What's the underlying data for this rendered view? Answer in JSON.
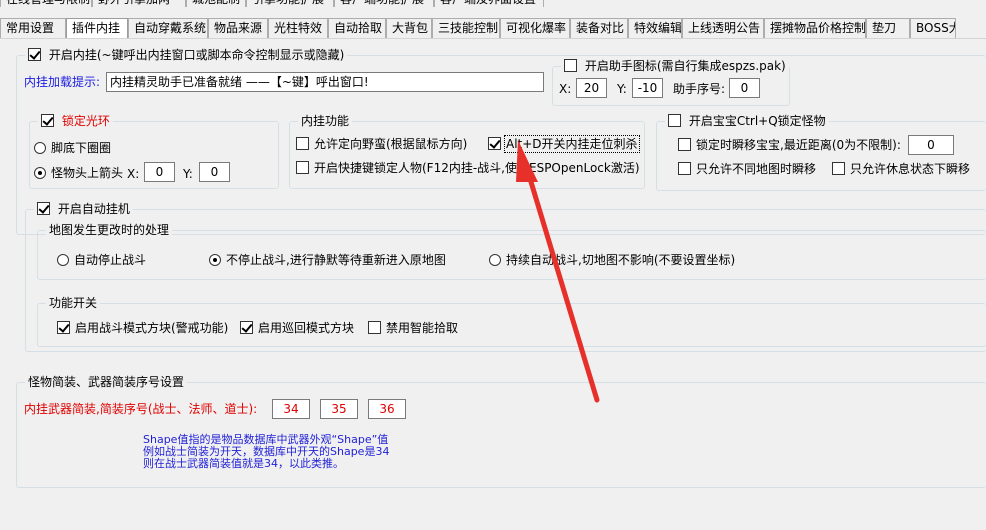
{
  "tabs_row1": [
    "在线管理与限制",
    "野外引掌加两",
    "城池配制",
    "引掌功能扩展",
    "客户端功能扩展",
    "客户端及界面设置"
  ],
  "tabs_row2": [
    "常用设置",
    "插件内挂",
    "自动穿戴系统",
    "物品来源",
    "光柱特效",
    "自动拾取",
    "大背包",
    "三技能控制",
    "可视化爆率",
    "装备对比",
    "特效编辑",
    "上线透明公告",
    "摆摊物品价格控制",
    "垫刀",
    "BOSS大血"
  ],
  "active_tab": "插件内挂",
  "enable_plugin": {
    "label": "开启内挂(~键呼出内挂窗口或脚本命令控制显示或隐藏)",
    "checked": true
  },
  "load_prompt": {
    "label": "内挂加载提示:",
    "value": "内挂精灵助手已准备就绪 ——【~键】呼出窗口!"
  },
  "assistant_icon": {
    "label": "开启助手图标(需自行集成espzs.pak)",
    "checked": false,
    "x_label": "X:",
    "x": "20",
    "y_label": "Y:",
    "y": "-10",
    "index_label": "助手序号:",
    "index": "0"
  },
  "lock_cursor": {
    "label": "锁定光环",
    "checked": true,
    "opt1": "脚底下圈圈",
    "opt2": "怪物头上箭头",
    "selected": "怪物头上箭头",
    "x_label": "X:",
    "x": "0",
    "y_label": "Y:",
    "y": "0"
  },
  "plugin_features": {
    "title": "内挂功能",
    "opt_wild": {
      "label": "允许定向野蛮(根据鼠标方向)",
      "checked": false
    },
    "opt_alt_d": {
      "label": "Alt+D开关内挂走位刺杀",
      "checked": true
    },
    "opt_hotkey": {
      "label": "开启快捷键锁定人物(F12内挂-战斗,使用ESPOpenLock激活)",
      "checked": false
    }
  },
  "pet_lock": {
    "label": "开启宝宝Ctrl+Q锁定怪物",
    "checked": false,
    "teleport": {
      "label": "锁定时瞬移宝宝,最近距离(0为不限制):",
      "checked": false,
      "value": "0"
    },
    "diff_map": {
      "label": "只允许不同地图时瞬移",
      "checked": false
    },
    "rest": {
      "label": "只允许休息状态下瞬移",
      "checked": false
    }
  },
  "auto_hang": {
    "label": "开启自动挂机",
    "checked": true,
    "map_change": {
      "title": "地图发生更改时的处理",
      "options": [
        "自动停止战斗",
        "不停止战斗,进行静默等待重新进入原地图",
        "持续自动战斗,切地图不影响(不要设置坐标)"
      ],
      "selected": 1
    },
    "switches": {
      "title": "功能开关",
      "battle_mode": {
        "label": "启用战斗模式方块(警戒功能)",
        "checked": true
      },
      "patrol_mode": {
        "label": "启用巡回模式方块",
        "checked": true
      },
      "disable_pickup": {
        "label": "禁用智能拾取",
        "checked": false
      }
    }
  },
  "weapon_shape": {
    "title": "怪物简装、武器简装序号设置",
    "label": "内挂武器简装,简装序号(战士、法师、道士):",
    "values": [
      "34",
      "35",
      "36"
    ],
    "note_lines": [
      "Shape值指的是物品数据库中武器外观“Shape”值",
      "例如战士简装为开天，数据库中开天的Shape是34",
      "则在战士武器简装值就是34，以此类推。"
    ]
  },
  "colors": {
    "accent_red": "#e00000",
    "link_blue": "#1c1ce0",
    "note_blue": "#1f1fd8",
    "arrow_red": "#e8302a"
  }
}
